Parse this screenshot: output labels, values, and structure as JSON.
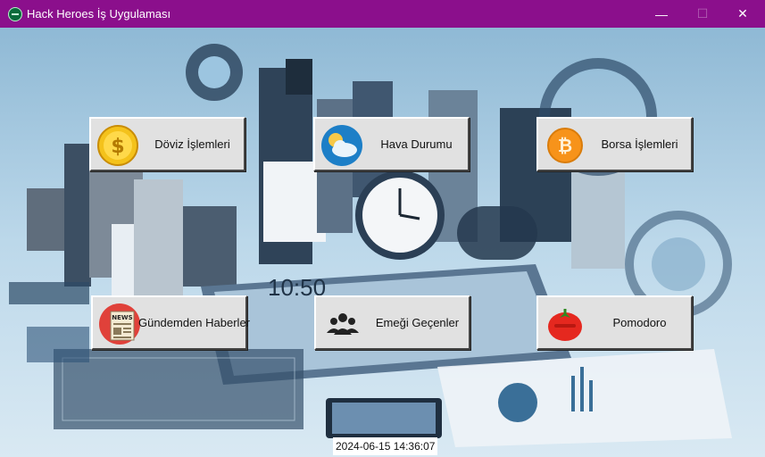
{
  "window": {
    "title": "Hack Heroes İş Uygulaması",
    "minimize": "—",
    "maximize": "☐",
    "close": "✕"
  },
  "buttons": {
    "doviz": {
      "label": "Döviz İşlemleri",
      "icon": "dollar-coin-icon"
    },
    "hava": {
      "label": "Hava Durumu",
      "icon": "weather-icon"
    },
    "borsa": {
      "label": "Borsa İşlemleri",
      "icon": "bitcoin-icon"
    },
    "haberler": {
      "label": "Gündemden Haberler",
      "icon": "news-icon"
    },
    "emegi": {
      "label": "Emeği Geçenler",
      "icon": "people-icon"
    },
    "pomodoro": {
      "label": "Pomodoro",
      "icon": "tomato-timer-icon"
    }
  },
  "status": {
    "datetime": "2024-06-15 14:36:07"
  },
  "background": {
    "clock_text": "10:50"
  },
  "colors": {
    "titlebar": "#8b0f8c",
    "button_face": "#e1e1e1",
    "background_tint": "#a9cce2"
  }
}
